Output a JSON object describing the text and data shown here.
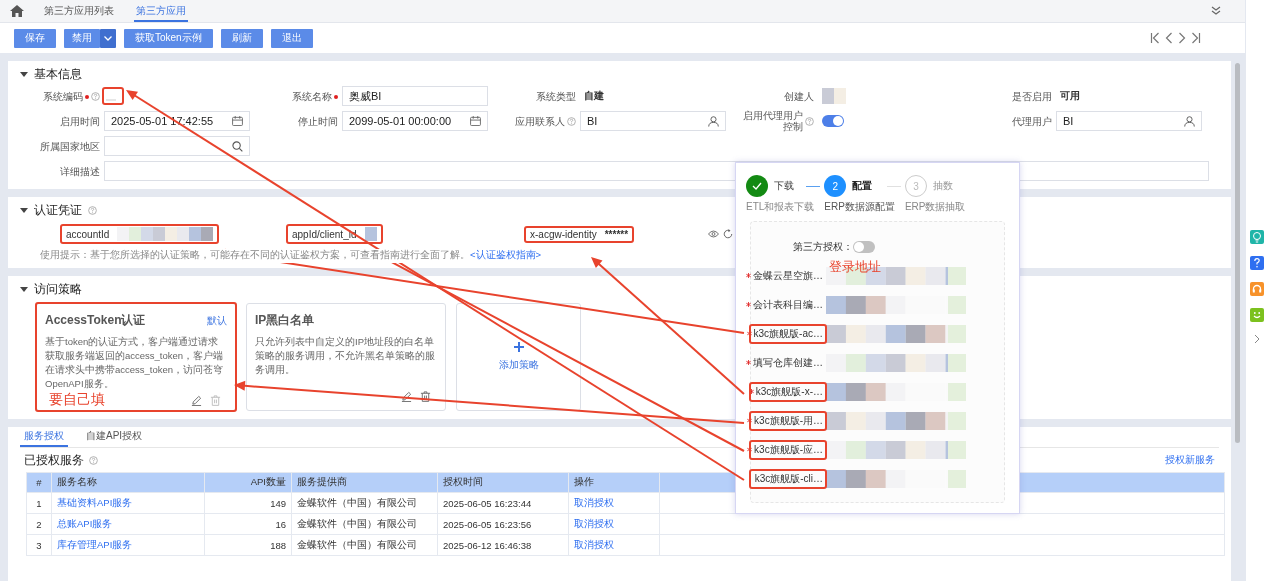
{
  "tabs": [
    {
      "label": "第三方应用列表",
      "selected": false
    },
    {
      "label": "第三方应用",
      "selected": true
    }
  ],
  "toolbar": [
    {
      "label": "保存",
      "kind": "button"
    },
    {
      "label": "禁用",
      "kind": "split"
    },
    {
      "label": "获取Token示例",
      "kind": "button"
    },
    {
      "label": "刷新",
      "kind": "button"
    },
    {
      "label": "退出",
      "kind": "button"
    }
  ],
  "basic_info": {
    "title": "基本信息",
    "rows": [
      [
        {
          "label": "系统编码",
          "required": true,
          "help": true,
          "kind": "blank",
          "highlighted": true
        },
        {
          "label": "系统名称",
          "required": true,
          "help": false,
          "kind": "input",
          "value": "奥威BI"
        },
        {
          "label": "系统类型",
          "required": false,
          "help": false,
          "kind": "text",
          "value": "自建"
        },
        {
          "label": "创建人",
          "required": false,
          "help": false,
          "kind": "masked"
        },
        {
          "label": "是否启用",
          "required": false,
          "help": false,
          "kind": "text",
          "value": "可用"
        }
      ],
      [
        {
          "label": "启用时间",
          "required": false,
          "help": false,
          "kind": "date",
          "value": "2025-05-01 17:42:55"
        },
        {
          "label": "停止时间",
          "required": false,
          "help": false,
          "kind": "date",
          "value": "2099-05-01 00:00:00"
        },
        {
          "label": "应用联系人",
          "required": false,
          "help": true,
          "kind": "person",
          "value": "BI"
        },
        {
          "label": "启用代理用户控制",
          "required": false,
          "help": true,
          "kind": "toggle",
          "on": true
        },
        {
          "label": "代理用户",
          "required": false,
          "help": false,
          "kind": "person",
          "value": "BI"
        }
      ],
      [
        {
          "label": "所属国家地区",
          "required": false,
          "help": false,
          "kind": "lookup"
        }
      ],
      [
        {
          "label": "详细描述",
          "required": false,
          "help": false,
          "kind": "textarea"
        }
      ]
    ]
  },
  "credentials": {
    "title": "认证凭证",
    "help": true,
    "items": [
      {
        "label": "accountId",
        "kind": "masked",
        "highlighted": true
      },
      {
        "label": "appId/client_id",
        "kind": "masked",
        "highlighted": true
      },
      {
        "label": "x-acgw-identity",
        "kind": "secret",
        "value": "******",
        "highlighted": true
      }
    ],
    "hint": "使用提示：基于您所选择的认证策略，可能存在不同的认证鉴权方案，可查看指南进行全面了解。",
    "hint_link": "<认证鉴权指南>"
  },
  "policies": {
    "title": "访问策略",
    "cards": [
      {
        "kind": "policy",
        "title": "AccessToken认证",
        "badge": "默认",
        "description": "基于token的认证方式，客户端通过请求获取服务端返回的access_token，客户端在请求头中携带access_token，访问苍穹OpenAPI服务。",
        "highlighted": true,
        "note": "要自己填"
      },
      {
        "kind": "policy",
        "title": "IP黑白名单",
        "description": "只允许列表中自定义的IP地址段的白名单策略的服务调用，不允许黑名单策略的服务调用。",
        "highlighted": false
      },
      {
        "kind": "add",
        "label": "添加策略"
      }
    ]
  },
  "services": {
    "tabs": [
      {
        "label": "服务授权",
        "selected": true
      },
      {
        "label": "自建API授权",
        "selected": false
      }
    ],
    "title": "已授权服务",
    "help": true,
    "action": "授权新服务",
    "table": {
      "columns": [
        "#",
        "服务名称",
        "API数量",
        "服务提供商",
        "授权时间",
        "操作"
      ],
      "rows": [
        [
          "1",
          "基础资料API服务",
          "149",
          "金蝶软件（中国）有限公司",
          "2025-06-05 16:23:44",
          "取消授权"
        ],
        [
          "2",
          "总账API服务",
          "16",
          "金蝶软件（中国）有限公司",
          "2025-06-05 16:23:56",
          "取消授权"
        ],
        [
          "3",
          "库存管理API服务",
          "188",
          "金蝶软件（中国）有限公司",
          "2025-06-12 16:46:38",
          "取消授权"
        ]
      ]
    }
  },
  "popup": {
    "steps": [
      {
        "title": "下载",
        "subtitle": "ETL和报表下载",
        "completed": true,
        "active": false
      },
      {
        "number": "2",
        "title": "配置",
        "subtitle": "ERP数据源配置",
        "completed": false,
        "active": true
      },
      {
        "number": "3",
        "title": "抽数",
        "subtitle": "ERP数据抽取",
        "completed": false,
        "active": false
      }
    ],
    "switch": {
      "label": "第三方授权：",
      "on": false
    },
    "fields": [
      {
        "label": "金蝶云星空旗…",
        "required": true,
        "highlighted": false
      },
      {
        "label": "会计表科目编…",
        "required": true,
        "highlighted": false
      },
      {
        "label": "k3c旗舰版-ac…",
        "required": true,
        "highlighted": true
      },
      {
        "label": "填写仓库创建…",
        "required": true,
        "highlighted": false
      },
      {
        "label": "k3c旗舰版-x-…",
        "required": true,
        "highlighted": true
      },
      {
        "label": "k3c旗舰版-用…",
        "required": true,
        "highlighted": true
      },
      {
        "label": "k3c旗舰版-应…",
        "required": true,
        "highlighted": true
      },
      {
        "label": "k3c旗舰版-cli…",
        "required": false,
        "highlighted": true
      }
    ],
    "note": "登录地址"
  }
}
